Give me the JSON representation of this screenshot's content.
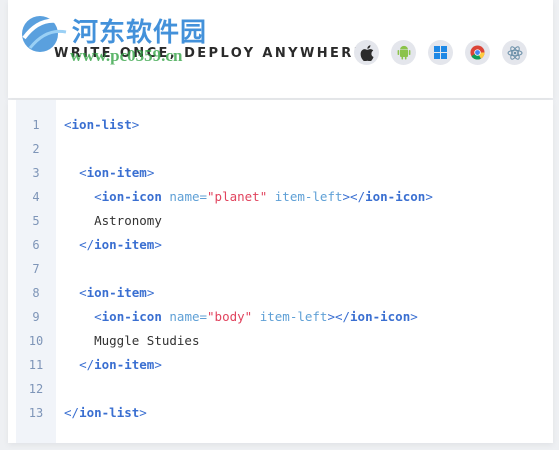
{
  "header": {
    "watermark_title": "河东软件园",
    "watermark_url": "www.pc0359.cn",
    "tagline": "WRITE ONCE, DEPLOY ANYWHERE.",
    "platforms": [
      "apple-icon",
      "android-icon",
      "windows-icon",
      "chrome-icon",
      "electron-icon"
    ]
  },
  "code": {
    "line_numbers": [
      "1",
      "2",
      "3",
      "4",
      "5",
      "6",
      "7",
      "8",
      "9",
      "10",
      "11",
      "12",
      "13"
    ],
    "t_ion_list": "ion-list",
    "t_ion_item": "ion-item",
    "t_ion_icon": "ion-icon",
    "a_name": "name",
    "a_item_left": "item-left",
    "v_planet": "\"planet\"",
    "v_body": "\"body\"",
    "text_astronomy": "Astronomy",
    "text_muggle": "Muggle Studies"
  },
  "colors": {
    "tag": "#3a6fd1",
    "attribute": "#5fa0d6",
    "string": "#e1445e",
    "gutter_bg": "#f1f4f9"
  }
}
